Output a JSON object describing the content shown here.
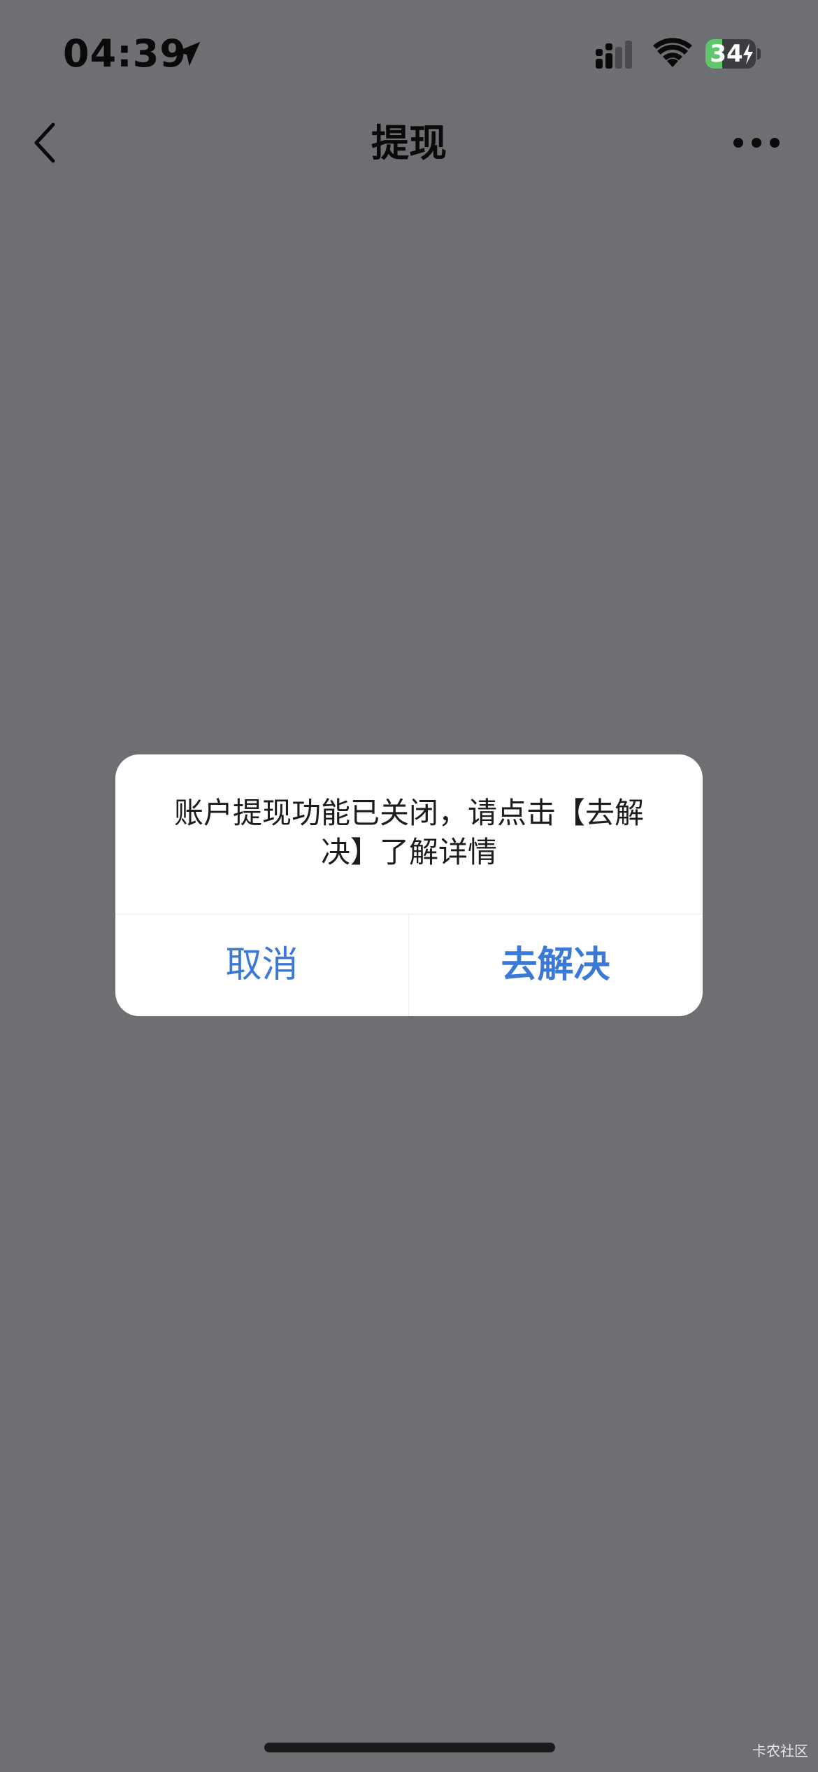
{
  "status_bar": {
    "time": "04:39",
    "battery_level": 34,
    "battery_text": "34",
    "battery_charging": true,
    "icons": [
      "location-arrow-icon",
      "cellular-signal-icon",
      "wifi-icon",
      "battery-icon",
      "bolt-icon"
    ]
  },
  "nav": {
    "title": "提现",
    "back_icon": "chevron-left-icon",
    "more_icon": "more-horizontal-icon"
  },
  "dialog": {
    "message": "账户提现功能已关闭，请点击【去解决】了解详情",
    "cancel_label": "取消",
    "resolve_label": "去解决"
  },
  "watermark": "卡农社区",
  "colors": {
    "overlay_background": "#6e6f72",
    "accent": "#3b79d6",
    "battery_green": "#5fc66b"
  }
}
